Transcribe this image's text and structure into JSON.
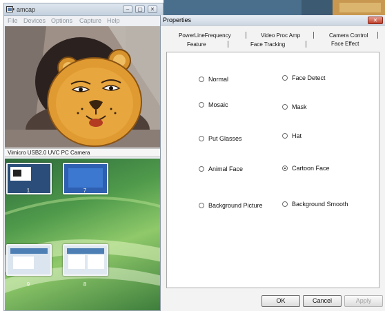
{
  "amcap": {
    "title": "amcap",
    "menu": [
      "File",
      "Devices",
      "Options",
      "Capture",
      "Help"
    ],
    "window_buttons": {
      "minimize": "‒",
      "maximize": "▢",
      "close": "✕"
    },
    "status": "Vimicro USB2.0 UVC PC Camera"
  },
  "desktop": {
    "thumbnails": [
      {
        "label": "1"
      },
      {
        "label": "7"
      },
      {
        "label": "9"
      },
      {
        "label": "8"
      }
    ]
  },
  "properties": {
    "title": "Properties",
    "close_label": "✕",
    "tabs_back": [
      "PowerLineFrequency",
      "Video Proc Amp",
      "Camera Control"
    ],
    "tabs_front": [
      "Feature",
      "Face Tracking",
      "Face Effect"
    ],
    "active_tab": "Face Effect",
    "options_left": [
      "Normal",
      "Mosaic",
      "Put Glasses",
      "Animal Face",
      "Background Picture"
    ],
    "options_right": [
      "Face Detect",
      "Mask",
      "Hat",
      "Cartoon Face",
      "Background Smooth"
    ],
    "selected": "Cartoon Face",
    "buttons": {
      "ok": "OK",
      "cancel": "Cancel",
      "apply": "Apply"
    }
  },
  "icons": [
    "camera-app-icon",
    "minimize-icon",
    "maximize-icon",
    "close-icon",
    "cartoon-lion-face-overlay"
  ]
}
